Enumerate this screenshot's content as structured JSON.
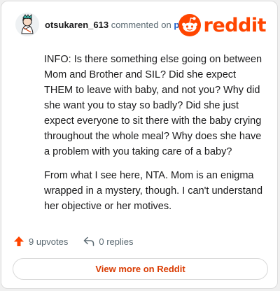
{
  "comment": {
    "username": "otsukaren_613",
    "commented_on": "commented on",
    "post_link": "post",
    "paragraphs": [
      "INFO: Is there something else going on between Mom and Brother and SIL? Did she expect THEM to leave with baby, and not you? Why did she want you to stay so badly? Did she just expect everyone to sit there with the baby crying throughout the whole meal? Why does she have a problem with you taking care of a baby?",
      "From what I see here, NTA. Mom is an enigma wrapped in a mystery, though. I can't understand her objective or her motives."
    ]
  },
  "brand": {
    "logo_text": "reddit",
    "icon": "reddit-alien-icon",
    "accent": "#ff4500"
  },
  "actions": {
    "upvotes": "9 upvotes",
    "replies": "0 replies"
  },
  "footer": {
    "view_more": "View more on Reddit"
  }
}
